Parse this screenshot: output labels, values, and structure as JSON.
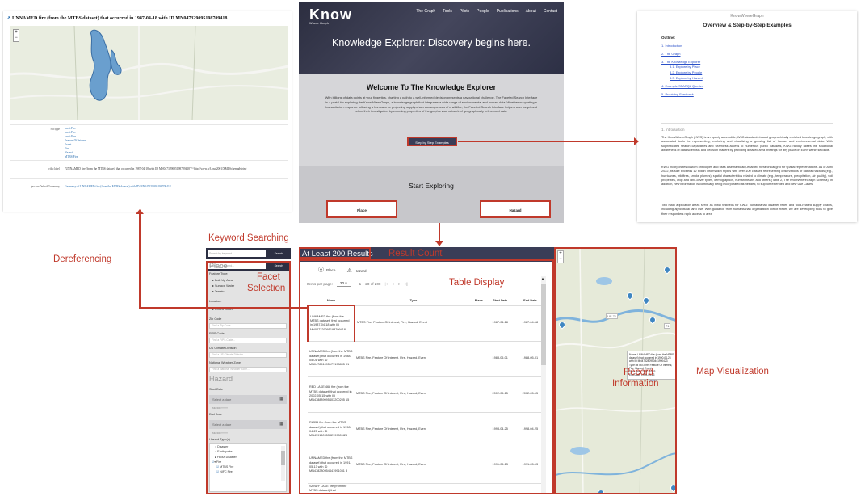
{
  "labels": {
    "dereferencing": "Dereferencing",
    "keyword_searching": "Keyword Searching",
    "facet_selection_1": "Facet",
    "facet_selection_2": "Selection",
    "result_count": "Result Count",
    "table_display": "Table Display",
    "record_info_1": "Record",
    "record_info_2": "Information",
    "map_visualization": "Map Visualization"
  },
  "deref": {
    "title": "UNNAMED fire (from the MTBS dataset) that occurred in 1987-04-18 with ID MN047329095198709418",
    "zoom_in": "+",
    "zoom_out": "−",
    "rows": [
      {
        "key": "rdf:type",
        "values": [
          "kwdi:Fire",
          "kwdi:Fire",
          "kwdi:Fire",
          "Feature Of Interest",
          "Event",
          "Fire",
          "Hazard",
          "MTBS Fire"
        ]
      },
      {
        "key": "rdfs:label",
        "value": "\"UNNAMED fire (from the MTBS dataset) that occurred in 1987-04-18 with ID MN047329095198709418\"^^http://www.w3.org/2001/XMLSchema#string"
      },
      {
        "key": "geo:hasDefaultGeometry",
        "value": "Geometry of UNNAMED fire (from the MTBS dataset) with ID MN047329095198709418"
      }
    ]
  },
  "kexp": {
    "logo": "Know",
    "logo_sub": "Where Graph",
    "nav": [
      "The Graph",
      "Tools",
      "Pilots",
      "People",
      "Publications",
      "About",
      "Contact"
    ],
    "hero_title": "Knowledge Explorer: Discovery begins here.",
    "welcome": "Welcome To The Knowledge Explorer",
    "blurb": "With billions of data points at your fingertips, charting a path to a well-informed decision presents a navigational challenge. The Faceted Search Interface is a portal for exploring the KnowWhereGraph, a knowledge graph that integrates a wide range of environmental and human data. Whether supporting a humanitarian response following a hurricane or projecting supply-chain consequences of a wildfire, the Faceted Search Interface helps a user target and refine their investigation by exposing properties of the graph's vast network of geographically referenced data.",
    "step_button": "Step by Step Examples",
    "start_exploring": "Start Exploring",
    "place_button": "Place",
    "hazard_button": "Hazard"
  },
  "doc": {
    "site": "KnowWhereGraph",
    "title": "Overview & Step-by-Step Examples",
    "outline": "Outline:",
    "toc": [
      "1. Introduction",
      "2. The Graph",
      "3. The Knowledge Explorer",
      "3.1. Explore by Place",
      "3.2. Explore by People",
      "3.3. Explore by Hazard",
      "4. Example SPARQL Queries",
      "5. Providing Feedback"
    ],
    "section": "1.    Introduction",
    "para1": "The KnowWhereGraph (KWG) is an openly accessible, W3C-standards-based geographically enriched knowledge graph, with associated tools for representing, exploring and visualizing a growing list of human and environmental data. With sophisticated search capabilities and seamless access to numerous public datasets, KWG rapidly raises the situational awareness of data scientists and decision makers by providing detailed area briefings for any place on Earth within seconds.",
    "para2": "KWG incorporates custom ontologies and uses a semantically-enabled hierarchical grid for spatial representations. As of April 2022, its size exceeds 12 billion information triples with over 100 classes representing observations of natural hazards (e.g., hurricanes, wildfires, smoke plumes), spatial characteristics related to climate (e.g., temperature, precipitation, air quality), soil properties, crop and land-cover types, demographics, human health, and others (Table 2, The KnowWhereGraph Schema). In addition, new information is continually being incorporated as needed, to support extended and new Use Cases.",
    "para3": "Two main application areas serve as initial testbeds for KWG: humanitarian disaster relief, and food-related supply chains, including agricultural land use. With guidance from humanitarian organization Direct Relief, we are developing tools to give their responders rapid access to area"
  },
  "filters": {
    "search_placeholder": "Search by keyword...",
    "search_button": "Search",
    "place_title": "Place",
    "feature_type": "Feature Type:",
    "feature_options": [
      "Built Up Area",
      "Surface Water",
      "Terrain"
    ],
    "location": "Location:",
    "location_value": "United States",
    "zip_label": "Zip Code",
    "zip_placeholder": "Find a Zip Code...",
    "fips_label": "FIPS Code",
    "fips_placeholder": "Find a FIPS Code...",
    "climate_label": "US Climate Division",
    "climate_placeholder": "Find a US Climate Division...",
    "nwz_label": "National Weather Zone",
    "nwz_placeholder": "Find a National Weather Zone...",
    "hazard_title": "Hazard",
    "start_label": "Start Date",
    "end_label": "End Date",
    "date_placeholder": "Select a date",
    "date_hint": "MM/DD/YYYY",
    "hazard_types": "Hazard Type(s)",
    "hazard_list": [
      "Disaster",
      "Earthquake",
      "FEMA Disaster",
      "Fire",
      "MTBS Fire",
      "NIFC Fire"
    ]
  },
  "results": {
    "count": "At Least 200 Results",
    "tab_place": "Place",
    "tab_hazard": "Hazard",
    "items_per_page": "Items per page:",
    "per_page_value": "20",
    "range": "1 – 20 of 200",
    "columns": [
      "Name",
      "Type",
      "Place",
      "Start Date",
      "End Date"
    ],
    "rows": [
      {
        "name": "UNNAMED fire (from the MTBS dataset) that occurred in 1987-04-18 with ID MN047329095198709418",
        "type": "MTBS Fire, Feature Of Interest, Fire, Hazard, Event",
        "place": "",
        "start": "1987-04-18",
        "end": "1987-04-18"
      },
      {
        "name": "UNNAMED fire (from the MTBS dataset) that occurred in 1988-05-01 with ID MN047851095177198805 01",
        "type": "MTBS Fire, Feature Of Interest, Fire, Hazard, Event",
        "place": "",
        "start": "1988-05-01",
        "end": "1988-05-01"
      },
      {
        "name": "RED LAKE 468 fire (from the MTBS dataset) that occurred in 2002-05-15 with ID MN478889095403200205 15",
        "type": "MTBS Fire, Feature Of Interest, Fire, Hazard, Event",
        "place": "",
        "start": "2002-05-15",
        "end": "2002-05-15"
      },
      {
        "name": "RL336 fire (from the MTBS dataset) that occurred in 1998-04-25 with ID MN4791609538219980 425",
        "type": "MTBS Fire, Feature Of Interest, Fire, Hazard, Event",
        "place": "",
        "start": "1998-04-25",
        "end": "1998-04-25"
      },
      {
        "name": "UNNAMED fire (from the MTBS dataset) that occurred in 1991-05-13 with ID MN478280954441991051 3",
        "type": "MTBS Fire, Feature Of Interest, Fire, Hazard, Event",
        "place": "",
        "start": "1991-05-13",
        "end": "1991-05-13"
      },
      {
        "name": "SANDY LAKE fire (from the MTBS dataset) that",
        "type": "",
        "place": "",
        "start": "",
        "end": ""
      }
    ]
  },
  "mapviz": {
    "zoom_in": "+",
    "zoom_out": "−",
    "road_1": "US 71",
    "road_2": "71",
    "popup": {
      "name": "Name: UNNAMED fire (from the MTBS dataset) that occurred in 1990-04-23 with ID MN478280950441990423",
      "type": "Type: MTBS Fire, Feature Of Interest, Fire, Hazard, Event",
      "start": "Start Date: 1990-04-23",
      "end": "End Date: 1990-04-23"
    }
  }
}
